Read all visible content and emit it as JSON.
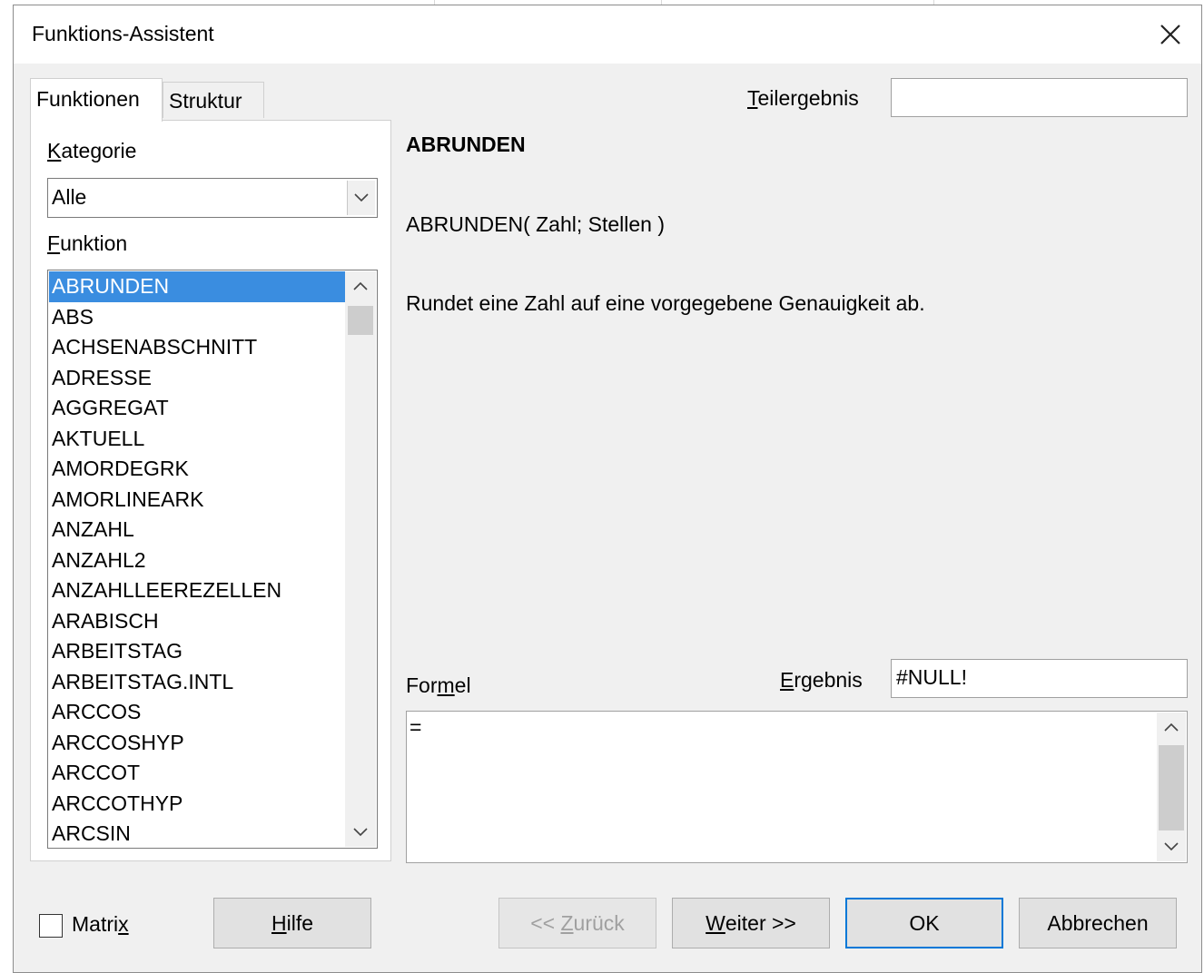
{
  "window": {
    "title": "Funktions-Assistent",
    "close_icon": "close-icon"
  },
  "tabs": [
    {
      "label": "Funktionen",
      "active": true
    },
    {
      "label": "Struktur",
      "active": false
    }
  ],
  "category": {
    "label_first": "K",
    "label_rest": "ategorie",
    "value": "Alle"
  },
  "function": {
    "label_first": "F",
    "label_rest": "unktion",
    "items": [
      "ABRUNDEN",
      "ABS",
      "ACHSENABSCHNITT",
      "ADRESSE",
      "AGGREGAT",
      "AKTUELL",
      "AMORDEGRK",
      "AMORLINEARK",
      "ANZAHL",
      "ANZAHL2",
      "ANZAHLLEEREZELLEN",
      "ARABISCH",
      "ARBEITSTAG",
      "ARBEITSTAG.INTL",
      "ARCCOS",
      "ARCCOSHYP",
      "ARCCOT",
      "ARCCOTHYP",
      "ARCSIN"
    ],
    "selected": "ABRUNDEN"
  },
  "subresult": {
    "label_first": "T",
    "label_rest": "eilergebnis",
    "value": ""
  },
  "detail": {
    "name": "ABRUNDEN",
    "signature": "ABRUNDEN( Zahl; Stellen )",
    "description": "Rundet eine Zahl auf eine vorgegebene Genauigkeit ab."
  },
  "formula": {
    "label_a": "For",
    "label_u": "m",
    "label_b": "el",
    "value": "="
  },
  "result": {
    "label_first": "E",
    "label_rest": "rgebnis",
    "value": "#NULL!"
  },
  "matrix": {
    "label_a": "Matri",
    "label_u": "x",
    "checked": false
  },
  "buttons": {
    "help": {
      "u": "H",
      "rest": "ilfe"
    },
    "back": {
      "pre": "<< ",
      "u": "Z",
      "rest": "urück",
      "enabled": false
    },
    "next": {
      "u": "W",
      "rest": "eiter >>"
    },
    "ok": "OK",
    "cancel": "Abbrechen"
  },
  "colors": {
    "selection": "#3a8de0",
    "dialog_bg": "#f0f0f0",
    "default_button_border": "#0078d7"
  }
}
